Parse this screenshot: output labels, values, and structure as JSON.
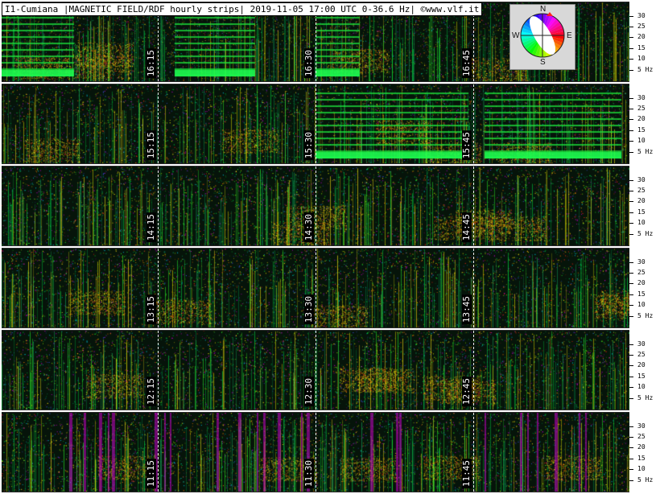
{
  "title": "I1-Cumiana |MAGNETIC FIELD/RDF hourly strips| 2019-11-05 17:00 UTC 0-36.6 Hz| ©www.vlf.it",
  "compass": {
    "n": "N",
    "s": "S",
    "e": "E",
    "w": "W"
  },
  "chart_data": {
    "type": "heatmap",
    "description_axis": "time vs frequency spectrogram strips",
    "frequency_range_hz": [
      0,
      36.6
    ],
    "y_ticks": [
      "30",
      "25",
      "20",
      "15",
      "10",
      "5 Hz"
    ],
    "y_tick_values": [
      30,
      25,
      20,
      15,
      10,
      5
    ],
    "strips": [
      {
        "hour": "16",
        "markers": [
          "16:15",
          "16:30",
          "16:45"
        ]
      },
      {
        "hour": "15",
        "markers": [
          "15:15",
          "15:30",
          "15:45"
        ]
      },
      {
        "hour": "14",
        "markers": [
          "14:15",
          "14:30",
          "14:45"
        ]
      },
      {
        "hour": "13",
        "markers": [
          "13:15",
          "13:30",
          "13:45"
        ]
      },
      {
        "hour": "12",
        "markers": [
          "12:15",
          "12:30",
          "12:45"
        ]
      },
      {
        "hour": "11",
        "markers": [
          "11:15",
          "11:30",
          "11:45"
        ]
      }
    ]
  }
}
